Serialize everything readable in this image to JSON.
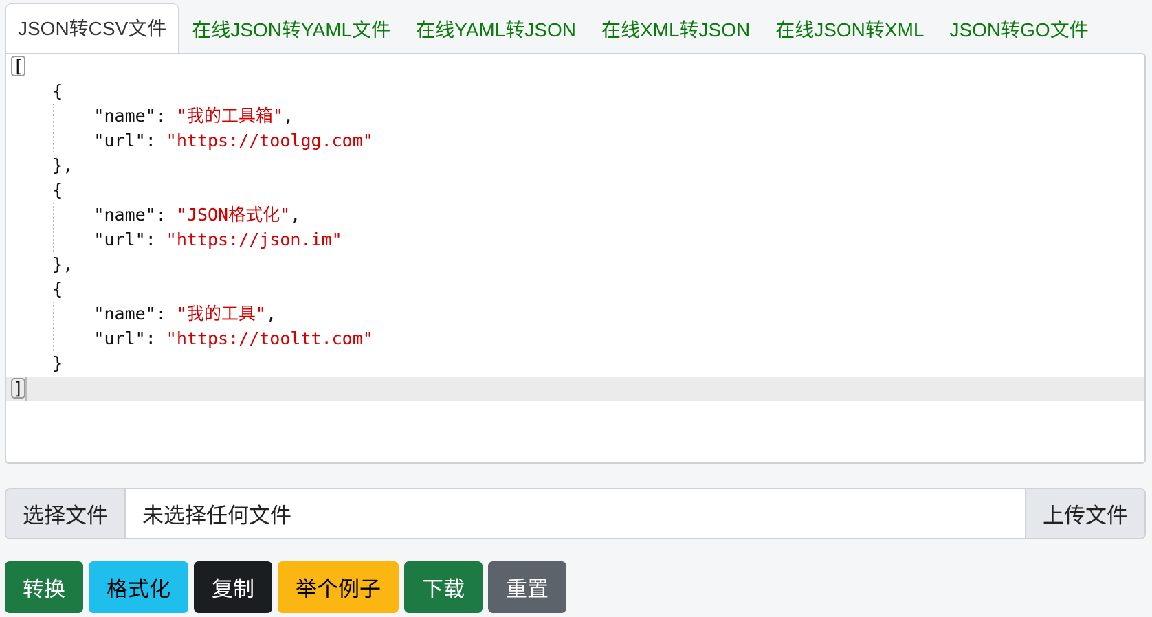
{
  "tabs": [
    {
      "label": "JSON转CSV文件",
      "active": true
    },
    {
      "label": "在线JSON转YAML文件",
      "active": false
    },
    {
      "label": "在线YAML转JSON",
      "active": false
    },
    {
      "label": "在线XML转JSON",
      "active": false
    },
    {
      "label": "在线JSON转XML",
      "active": false
    },
    {
      "label": "JSON转GO文件",
      "active": false
    }
  ],
  "editor": {
    "open_bracket": "[",
    "close_bracket": "]",
    "items": [
      {
        "name_key": "\"name\"",
        "name_value": "\"我的工具箱\"",
        "url_key": "\"url\"",
        "url_value": "\"https://toolgg.com\""
      },
      {
        "name_key": "\"name\"",
        "name_value": "\"JSON格式化\"",
        "url_key": "\"url\"",
        "url_value": "\"https://json.im\""
      },
      {
        "name_key": "\"name\"",
        "name_value": "\"我的工具\"",
        "url_key": "\"url\"",
        "url_value": "\"https://tooltt.com\""
      }
    ]
  },
  "file": {
    "choose_label": "选择文件",
    "status": "未选择任何文件",
    "upload_label": "上传文件"
  },
  "actions": [
    {
      "label": "转换",
      "bg": "#1c7a42",
      "fg": "#ffffff"
    },
    {
      "label": "格式化",
      "bg": "#1ebfec",
      "fg": "#000000"
    },
    {
      "label": "复制",
      "bg": "#1b1e21",
      "fg": "#ffffff"
    },
    {
      "label": "举个例子",
      "bg": "#fcb612",
      "fg": "#000000"
    },
    {
      "label": "下载",
      "bg": "#1c7a42",
      "fg": "#ffffff"
    },
    {
      "label": "重置",
      "bg": "#5c636b",
      "fg": "#ffffff"
    }
  ]
}
